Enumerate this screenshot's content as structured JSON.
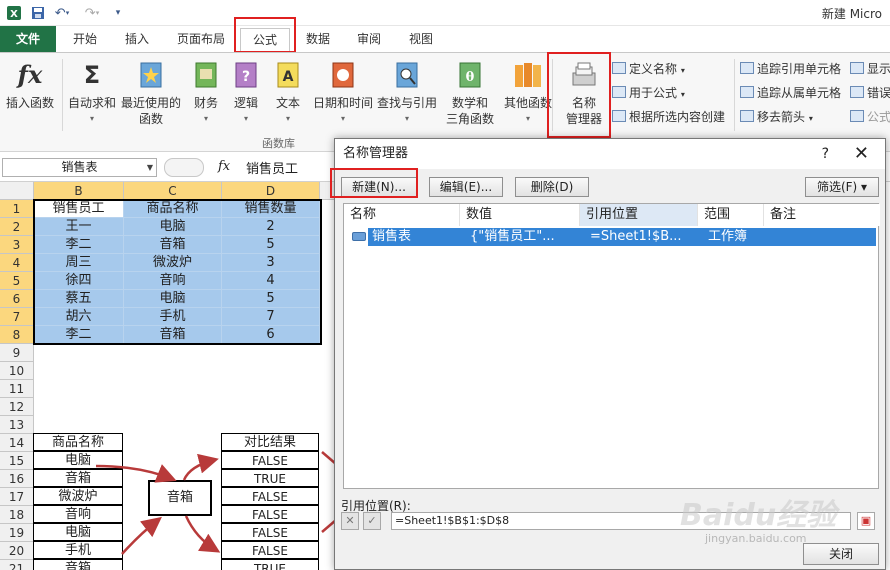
{
  "app": {
    "title": "新建 Micro",
    "icon": "excel-icon",
    "qat": {
      "save": "save-icon",
      "undo": "undo-icon",
      "redo": "redo-icon",
      "customize": "customize-icon"
    }
  },
  "tabs": [
    {
      "label": "文件"
    },
    {
      "label": "开始"
    },
    {
      "label": "插入"
    },
    {
      "label": "页面布局"
    },
    {
      "label": "公式"
    },
    {
      "label": "数据"
    },
    {
      "label": "审阅"
    },
    {
      "label": "视图"
    }
  ],
  "ribbon": {
    "group_label": "函数库",
    "buttons": [
      {
        "line1": "插入函数",
        "line2": "",
        "icon": "fx-icon"
      },
      {
        "line1": "自动求和",
        "line2": "",
        "icon": "sigma-icon"
      },
      {
        "line1": "最近使用的",
        "line2": "函数",
        "icon": "star-book-icon"
      },
      {
        "line1": "财务",
        "line2": "",
        "icon": "finance-book-icon"
      },
      {
        "line1": "逻辑",
        "line2": "",
        "icon": "logic-book-icon"
      },
      {
        "line1": "文本",
        "line2": "",
        "icon": "text-book-icon"
      },
      {
        "line1": "日期和时间",
        "line2": "",
        "icon": "date-book-icon"
      },
      {
        "line1": "查找与引用",
        "line2": "",
        "icon": "lookup-book-icon"
      },
      {
        "line1": "数学和",
        "line2": "三角函数",
        "icon": "math-book-icon"
      },
      {
        "line1": "其他函数",
        "line2": "",
        "icon": "more-books-icon"
      },
      {
        "line1": "名称",
        "line2": "管理器",
        "icon": "name-manager-icon"
      }
    ],
    "names_small": [
      {
        "label": "定义名称"
      },
      {
        "label": "用于公式"
      },
      {
        "label": "根据所选内容创建"
      }
    ],
    "audit_small": [
      {
        "label": "追踪引用单元格"
      },
      {
        "label": "追踪从属单元格"
      },
      {
        "label": "移去箭头"
      }
    ],
    "right_small": [
      {
        "label": "显示"
      },
      {
        "label": "错误"
      },
      {
        "label": "公式"
      }
    ]
  },
  "formula_bar": {
    "name_box": "销售表",
    "fx": "fx",
    "content": "销售员工"
  },
  "grid": {
    "columns": [
      "B",
      "C",
      "D"
    ],
    "rows": [
      "1",
      "2",
      "3",
      "4",
      "5",
      "6",
      "7",
      "8",
      "9",
      "10",
      "11",
      "12",
      "13",
      "14",
      "15",
      "16",
      "17",
      "18",
      "19",
      "20",
      "21"
    ],
    "table": [
      [
        "销售员工",
        "商品名称",
        "销售数量"
      ],
      [
        "王一",
        "电脑",
        "2"
      ],
      [
        "李二",
        "音箱",
        "5"
      ],
      [
        "周三",
        "微波炉",
        "3"
      ],
      [
        "徐四",
        "音响",
        "4"
      ],
      [
        "蔡五",
        "电脑",
        "5"
      ],
      [
        "胡六",
        "手机",
        "7"
      ],
      [
        "李二",
        "音箱",
        "6"
      ]
    ],
    "lower_b": [
      "商品名称",
      "电脑",
      "音箱",
      "微波炉",
      "音响",
      "电脑",
      "手机",
      "音箱"
    ],
    "lower_d": [
      "对比结果",
      "FALSE",
      "TRUE",
      "FALSE",
      "FALSE",
      "FALSE",
      "FALSE",
      "TRUE"
    ],
    "lookup_value": "音箱"
  },
  "dialog": {
    "title": "名称管理器",
    "help": "?",
    "close": "✕",
    "btn_new": "新建(N)...",
    "btn_edit": "编辑(E)...",
    "btn_delete": "删除(D)",
    "btn_filter": "筛选(F) ▾",
    "headers": [
      "名称",
      "数值",
      "引用位置",
      "范围",
      "备注"
    ],
    "entries": [
      {
        "name": "销售表",
        "value": "{\"销售员工\"...",
        "ref": "=Sheet1!$B...",
        "scope": "工作簿",
        "note": ""
      }
    ],
    "ref_label": "引用位置(R):",
    "ref_value": "=Sheet1!$B$1:$D$8",
    "btn_close": "关闭"
  },
  "watermark": {
    "main": "Baidu经验",
    "sub": "jingyan.baidu.com"
  },
  "colors": {
    "file_tab": "#217346",
    "highlight": "#a6c9ec",
    "selection": "#3384d6",
    "annotation": "#e02020"
  }
}
